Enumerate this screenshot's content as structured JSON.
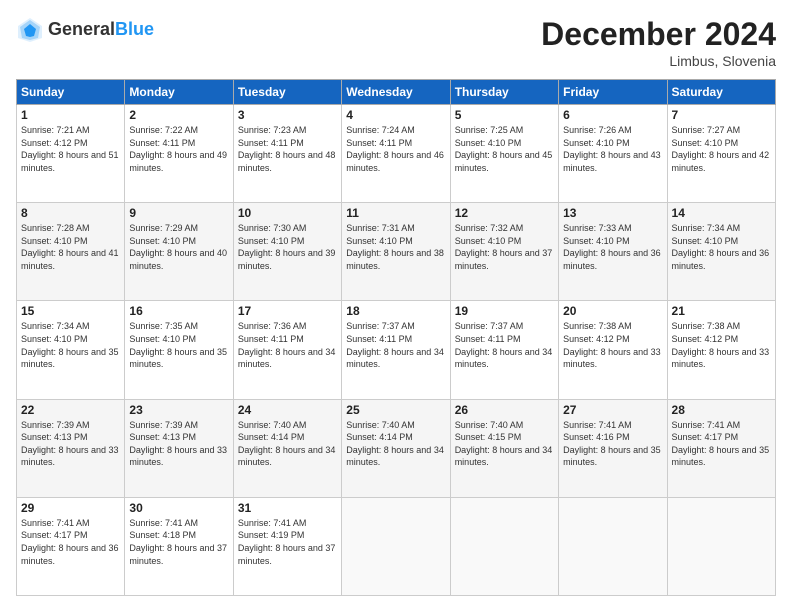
{
  "logo": {
    "general": "General",
    "blue": "Blue"
  },
  "header": {
    "title": "December 2024",
    "location": "Limbus, Slovenia"
  },
  "days_of_week": [
    "Sunday",
    "Monday",
    "Tuesday",
    "Wednesday",
    "Thursday",
    "Friday",
    "Saturday"
  ],
  "weeks": [
    [
      {
        "day": "1",
        "sunrise": "7:21 AM",
        "sunset": "4:12 PM",
        "daylight": "8 hours and 51 minutes."
      },
      {
        "day": "2",
        "sunrise": "7:22 AM",
        "sunset": "4:11 PM",
        "daylight": "8 hours and 49 minutes."
      },
      {
        "day": "3",
        "sunrise": "7:23 AM",
        "sunset": "4:11 PM",
        "daylight": "8 hours and 48 minutes."
      },
      {
        "day": "4",
        "sunrise": "7:24 AM",
        "sunset": "4:11 PM",
        "daylight": "8 hours and 46 minutes."
      },
      {
        "day": "5",
        "sunrise": "7:25 AM",
        "sunset": "4:10 PM",
        "daylight": "8 hours and 45 minutes."
      },
      {
        "day": "6",
        "sunrise": "7:26 AM",
        "sunset": "4:10 PM",
        "daylight": "8 hours and 43 minutes."
      },
      {
        "day": "7",
        "sunrise": "7:27 AM",
        "sunset": "4:10 PM",
        "daylight": "8 hours and 42 minutes."
      }
    ],
    [
      {
        "day": "8",
        "sunrise": "7:28 AM",
        "sunset": "4:10 PM",
        "daylight": "8 hours and 41 minutes."
      },
      {
        "day": "9",
        "sunrise": "7:29 AM",
        "sunset": "4:10 PM",
        "daylight": "8 hours and 40 minutes."
      },
      {
        "day": "10",
        "sunrise": "7:30 AM",
        "sunset": "4:10 PM",
        "daylight": "8 hours and 39 minutes."
      },
      {
        "day": "11",
        "sunrise": "7:31 AM",
        "sunset": "4:10 PM",
        "daylight": "8 hours and 38 minutes."
      },
      {
        "day": "12",
        "sunrise": "7:32 AM",
        "sunset": "4:10 PM",
        "daylight": "8 hours and 37 minutes."
      },
      {
        "day": "13",
        "sunrise": "7:33 AM",
        "sunset": "4:10 PM",
        "daylight": "8 hours and 36 minutes."
      },
      {
        "day": "14",
        "sunrise": "7:34 AM",
        "sunset": "4:10 PM",
        "daylight": "8 hours and 36 minutes."
      }
    ],
    [
      {
        "day": "15",
        "sunrise": "7:34 AM",
        "sunset": "4:10 PM",
        "daylight": "8 hours and 35 minutes."
      },
      {
        "day": "16",
        "sunrise": "7:35 AM",
        "sunset": "4:10 PM",
        "daylight": "8 hours and 35 minutes."
      },
      {
        "day": "17",
        "sunrise": "7:36 AM",
        "sunset": "4:11 PM",
        "daylight": "8 hours and 34 minutes."
      },
      {
        "day": "18",
        "sunrise": "7:37 AM",
        "sunset": "4:11 PM",
        "daylight": "8 hours and 34 minutes."
      },
      {
        "day": "19",
        "sunrise": "7:37 AM",
        "sunset": "4:11 PM",
        "daylight": "8 hours and 34 minutes."
      },
      {
        "day": "20",
        "sunrise": "7:38 AM",
        "sunset": "4:12 PM",
        "daylight": "8 hours and 33 minutes."
      },
      {
        "day": "21",
        "sunrise": "7:38 AM",
        "sunset": "4:12 PM",
        "daylight": "8 hours and 33 minutes."
      }
    ],
    [
      {
        "day": "22",
        "sunrise": "7:39 AM",
        "sunset": "4:13 PM",
        "daylight": "8 hours and 33 minutes."
      },
      {
        "day": "23",
        "sunrise": "7:39 AM",
        "sunset": "4:13 PM",
        "daylight": "8 hours and 33 minutes."
      },
      {
        "day": "24",
        "sunrise": "7:40 AM",
        "sunset": "4:14 PM",
        "daylight": "8 hours and 34 minutes."
      },
      {
        "day": "25",
        "sunrise": "7:40 AM",
        "sunset": "4:14 PM",
        "daylight": "8 hours and 34 minutes."
      },
      {
        "day": "26",
        "sunrise": "7:40 AM",
        "sunset": "4:15 PM",
        "daylight": "8 hours and 34 minutes."
      },
      {
        "day": "27",
        "sunrise": "7:41 AM",
        "sunset": "4:16 PM",
        "daylight": "8 hours and 35 minutes."
      },
      {
        "day": "28",
        "sunrise": "7:41 AM",
        "sunset": "4:17 PM",
        "daylight": "8 hours and 35 minutes."
      }
    ],
    [
      {
        "day": "29",
        "sunrise": "7:41 AM",
        "sunset": "4:17 PM",
        "daylight": "8 hours and 36 minutes."
      },
      {
        "day": "30",
        "sunrise": "7:41 AM",
        "sunset": "4:18 PM",
        "daylight": "8 hours and 37 minutes."
      },
      {
        "day": "31",
        "sunrise": "7:41 AM",
        "sunset": "4:19 PM",
        "daylight": "8 hours and 37 minutes."
      },
      null,
      null,
      null,
      null
    ]
  ]
}
